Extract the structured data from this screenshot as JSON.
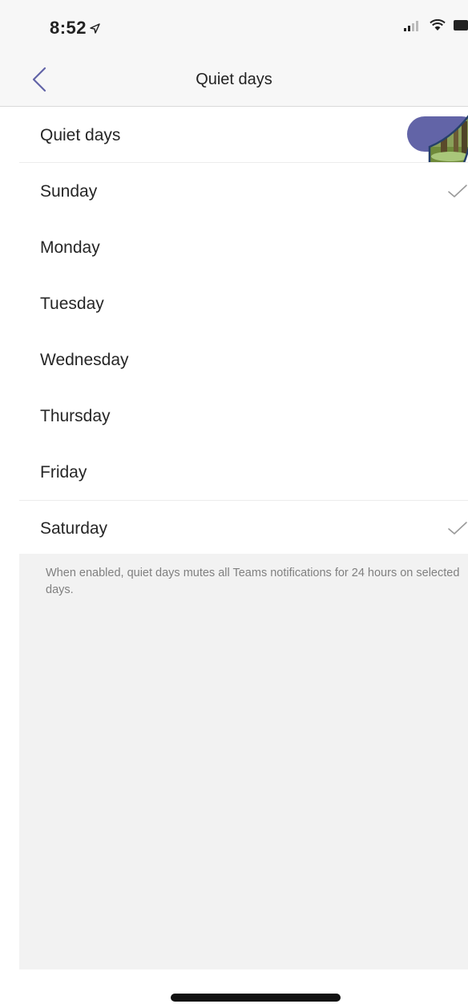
{
  "status_bar": {
    "time": "8:52",
    "location_icon": "location-arrow-icon",
    "signal_icon": "cellular-signal-icon",
    "wifi_icon": "wifi-icon",
    "battery_icon": "battery-icon"
  },
  "nav": {
    "back_icon": "chevron-left-icon",
    "title": "Quiet days"
  },
  "quiet_days_toggle": {
    "label": "Quiet days",
    "enabled": true,
    "accent_color": "#6264a7"
  },
  "days": [
    {
      "label": "Sunday",
      "selected": true
    },
    {
      "label": "Monday",
      "selected": false
    },
    {
      "label": "Tuesday",
      "selected": false
    },
    {
      "label": "Wednesday",
      "selected": false
    },
    {
      "label": "Thursday",
      "selected": false
    },
    {
      "label": "Friday",
      "selected": false
    },
    {
      "label": "Saturday",
      "selected": true
    }
  ],
  "footer_note": "When enabled, quiet days mutes all Teams notifications for 24 hours on selected days.",
  "colors": {
    "accent": "#6264a7",
    "checkmark": "#9a9a9a",
    "background_grouped": "#f2f2f2"
  }
}
